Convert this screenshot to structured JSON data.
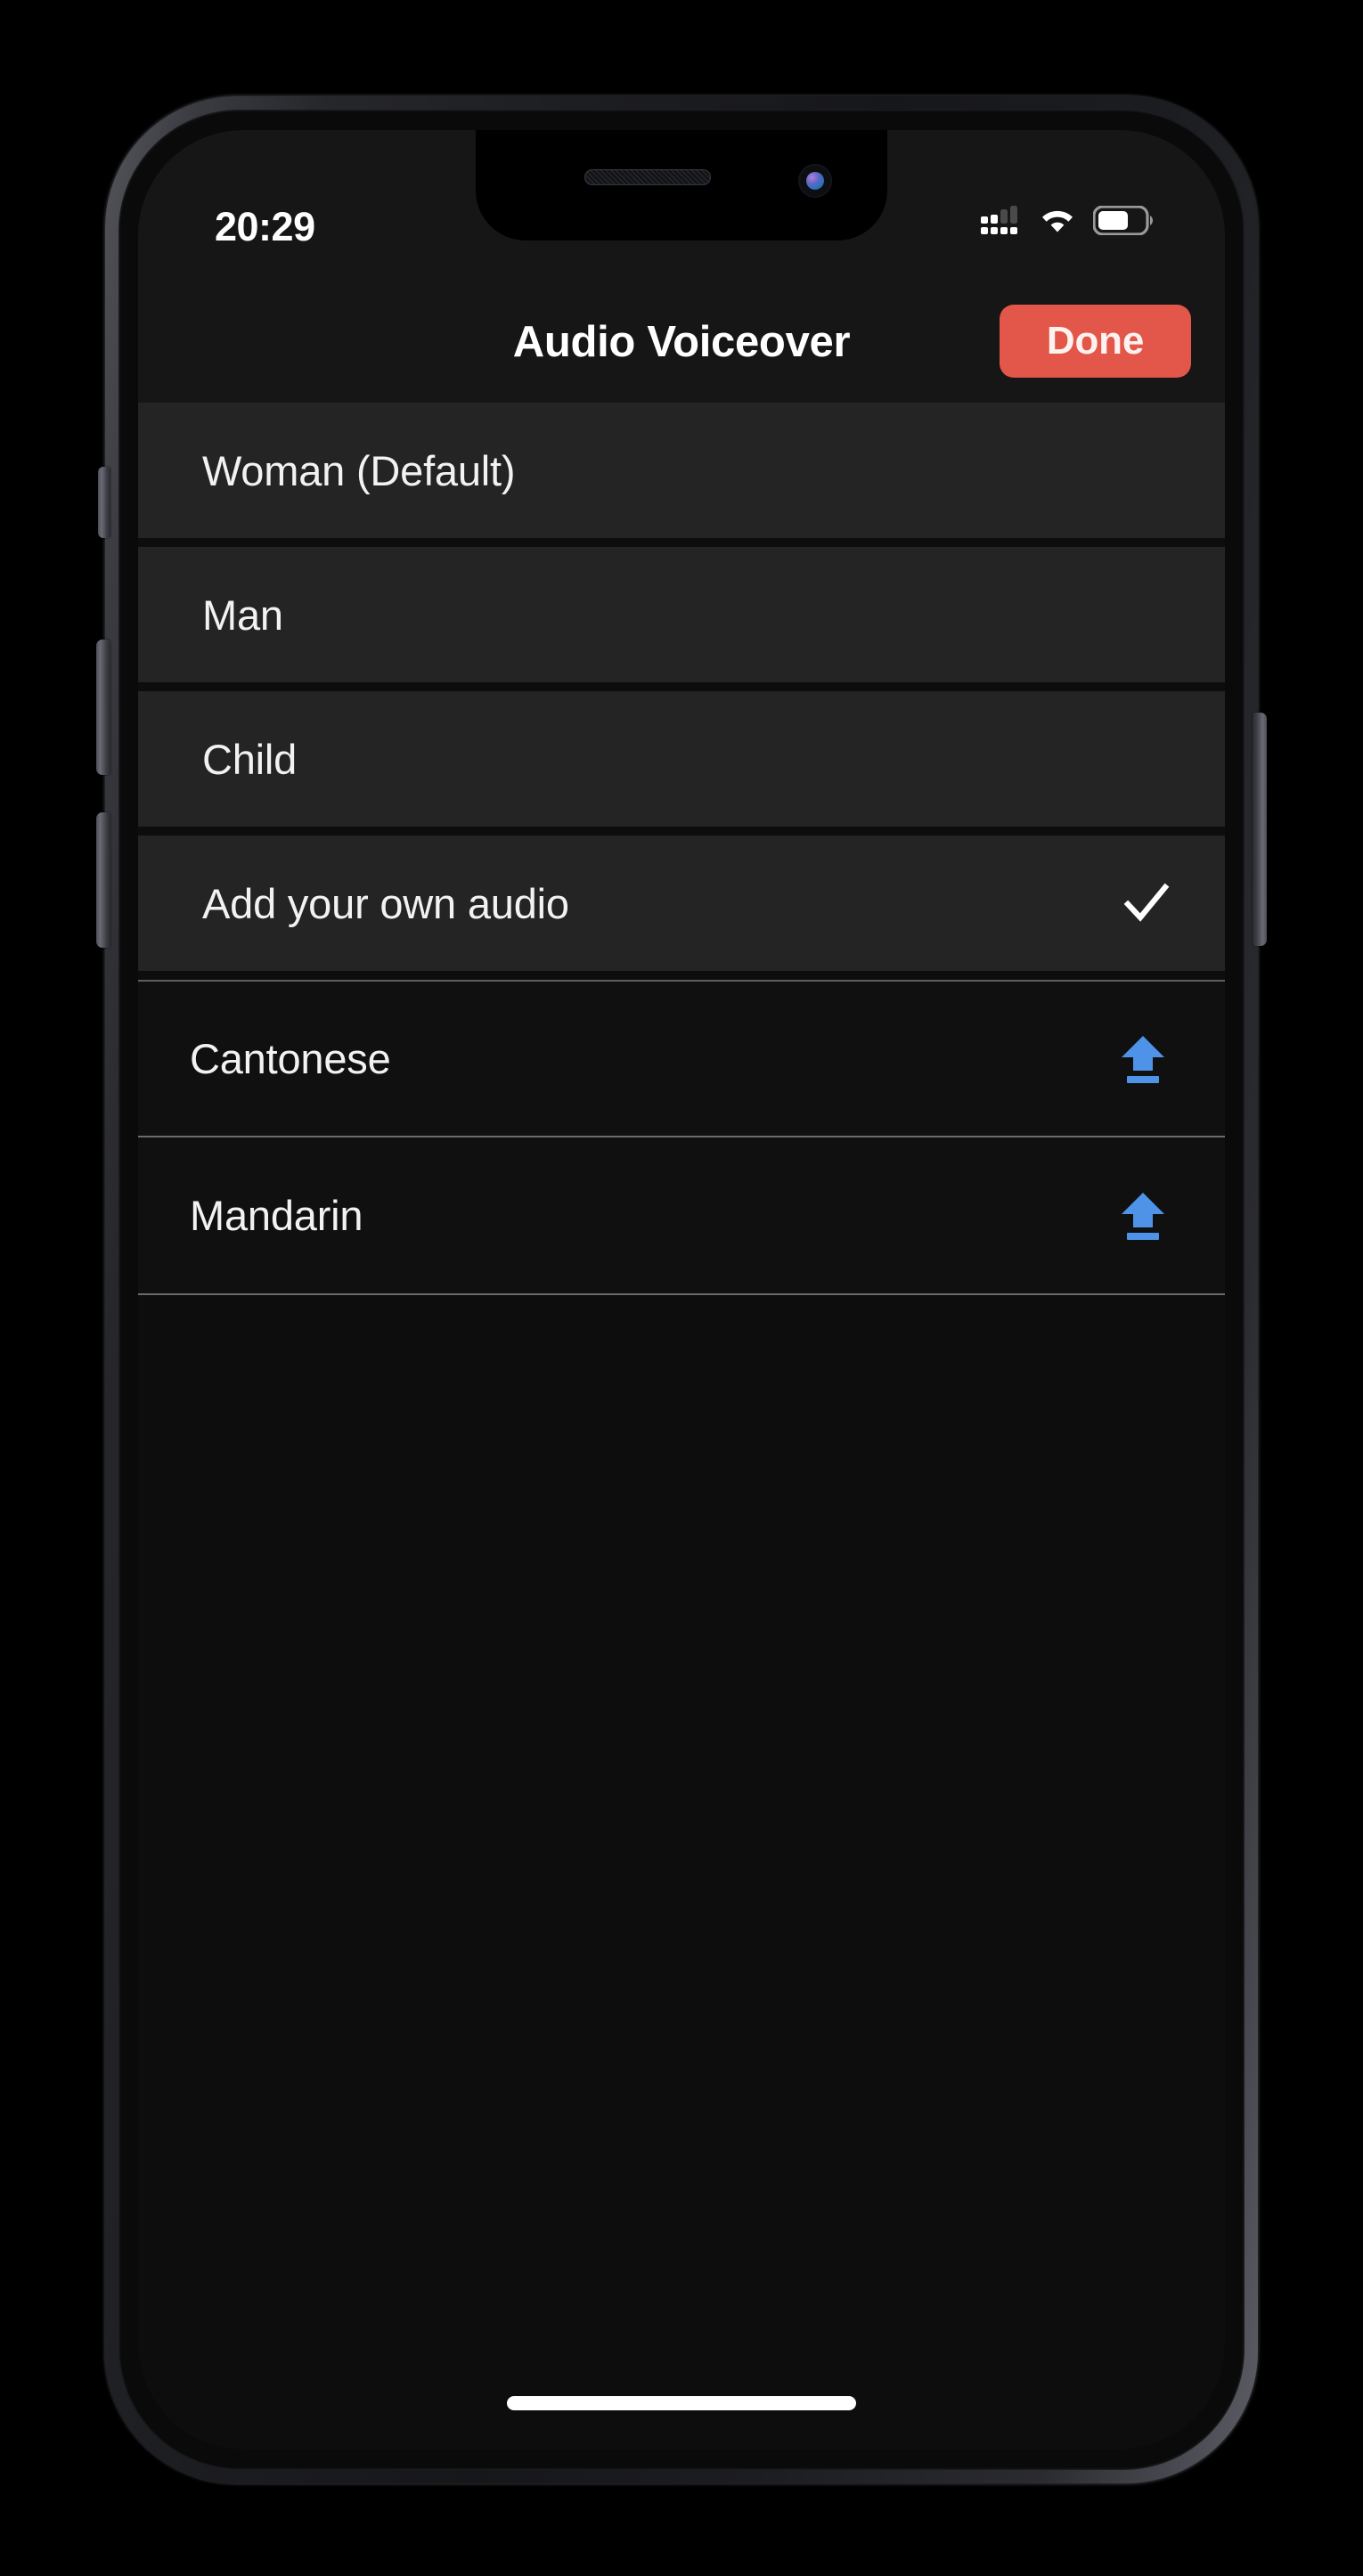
{
  "status_bar": {
    "time": "20:29",
    "cellular_icon": "cellular-signal-dots-icon",
    "wifi_icon": "wifi-icon",
    "battery_icon": "battery-icon",
    "battery_level_percent": 62
  },
  "header": {
    "title": "Audio Voiceover",
    "done_label": "Done"
  },
  "voice_options": [
    {
      "label": "Woman (Default)",
      "selected": false,
      "accessory": "none"
    },
    {
      "label": "Man",
      "selected": false,
      "accessory": "none"
    },
    {
      "label": "Child",
      "selected": false,
      "accessory": "none"
    },
    {
      "label": "Add your own audio",
      "selected": true,
      "accessory": "check-icon"
    }
  ],
  "language_options": [
    {
      "label": "Cantonese",
      "accessory": "upload-icon"
    },
    {
      "label": "Mandarin",
      "accessory": "upload-icon"
    }
  ],
  "colors": {
    "accent_done": "#e2574a",
    "upload_blue": "#4f93e8",
    "row_background": "#242424",
    "language_row_background": "#101010",
    "screen_background": "#0d0d0d",
    "header_background": "#161616",
    "text_primary": "#f2f2f2"
  },
  "home_indicator": "home-indicator"
}
